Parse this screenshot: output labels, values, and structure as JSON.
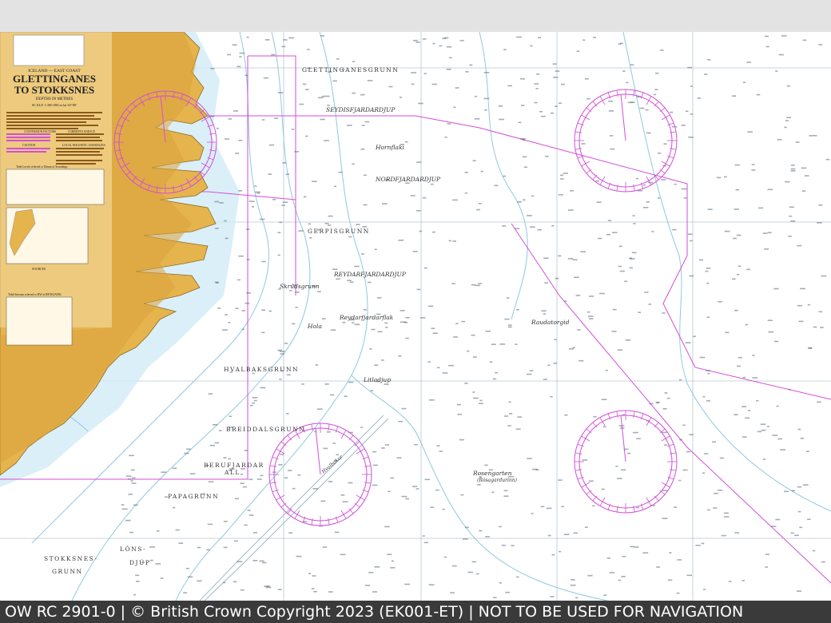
{
  "chart": {
    "region": "ICELAND — EAST COAST",
    "title_line1": "GLETTINGANES",
    "title_line2": "TO STOKKSNES",
    "depths_note": "DEPTHS IN METRES",
    "scale": "SCALE 1:300 000 at lat 65°00'",
    "section_headers": [
      "CONVERSION FACTORS",
      "CAUTION",
      "CURRENTS AND ICE",
      "LOCAL MAGNETIC ANOMALIES",
      "Tidal Levels referred to Datum of Soundings",
      "SOURCES",
      "Tidal Streams referred to HW at REYKJAVIK"
    ]
  },
  "place_labels": [
    {
      "id": "glettinganesgrunn",
      "text": "GLETTINGANESGRUNN",
      "style": "caps"
    },
    {
      "id": "seydisfjardardjup",
      "text": "SEYDISFJARDARDJUP",
      "style": "caps-italic"
    },
    {
      "id": "hornflaki",
      "text": "Hornflaki",
      "style": "italic"
    },
    {
      "id": "nordfjardardjup",
      "text": "NORDFJARDARDJUP",
      "style": "caps-italic"
    },
    {
      "id": "gerpisgrunn",
      "text": "GERPISGRUNN",
      "style": "caps"
    },
    {
      "id": "reydarfjardardjup",
      "text": "REYDARFJARDARDJUP",
      "style": "caps-italic"
    },
    {
      "id": "skrudsgrunn",
      "text": "Skrúdsgrunn",
      "style": "italic"
    },
    {
      "id": "reydarfjardarflak",
      "text": "Reydarfjardarflak",
      "style": "italic"
    },
    {
      "id": "hola",
      "text": "Hola",
      "style": "italic"
    },
    {
      "id": "raudatorgid",
      "text": "Raudatorgid",
      "style": "italic"
    },
    {
      "id": "hvalbaksgrunn",
      "text": "HVALBAKSGRUNN",
      "style": "caps"
    },
    {
      "id": "litladjup",
      "text": "Litladjup",
      "style": "italic"
    },
    {
      "id": "breiddalsgrunn",
      "text": "BREIDDALSGRUNN",
      "style": "caps"
    },
    {
      "id": "berufjardarall-1",
      "text": "BERUFJARDAR",
      "style": "caps"
    },
    {
      "id": "berufjardarall-2",
      "text": "ALL",
      "style": "caps"
    },
    {
      "id": "papagrunn",
      "text": "PAPAGRUNN",
      "style": "caps"
    },
    {
      "id": "rosengarten-1",
      "text": "Rosengarten",
      "style": "italic"
    },
    {
      "id": "rosengarten-2",
      "text": "(Rósagardurinn)",
      "style": "italic"
    },
    {
      "id": "lonsdjup-1",
      "text": "LÓNS-",
      "style": "caps"
    },
    {
      "id": "lonsdjup-2",
      "text": "DJÚP",
      "style": "caps"
    },
    {
      "id": "stokksnesgrunn-1",
      "text": "STOKKSNES-",
      "style": "caps"
    },
    {
      "id": "stokksnesgrunn-2",
      "text": "GRUNN",
      "style": "caps"
    },
    {
      "id": "hvalbakur",
      "text": "Hvalbakur",
      "style": "italic"
    }
  ],
  "compass_roses": 4,
  "colors": {
    "land": "#e6b44c",
    "land_shade": "#d9a23d",
    "sea": "#ffffff",
    "shallow": "#cfeaf5",
    "depth_contour": "#8fc9e0",
    "magenta": "#d24fd8",
    "grid": "#b9c6d2",
    "footer_bg": "#3a3a3a"
  },
  "footer": {
    "text": "OW RC 2901-0 | © British Crown Copyright 2023 (EK001-ET) | NOT TO BE USED FOR NAVIGATION"
  }
}
